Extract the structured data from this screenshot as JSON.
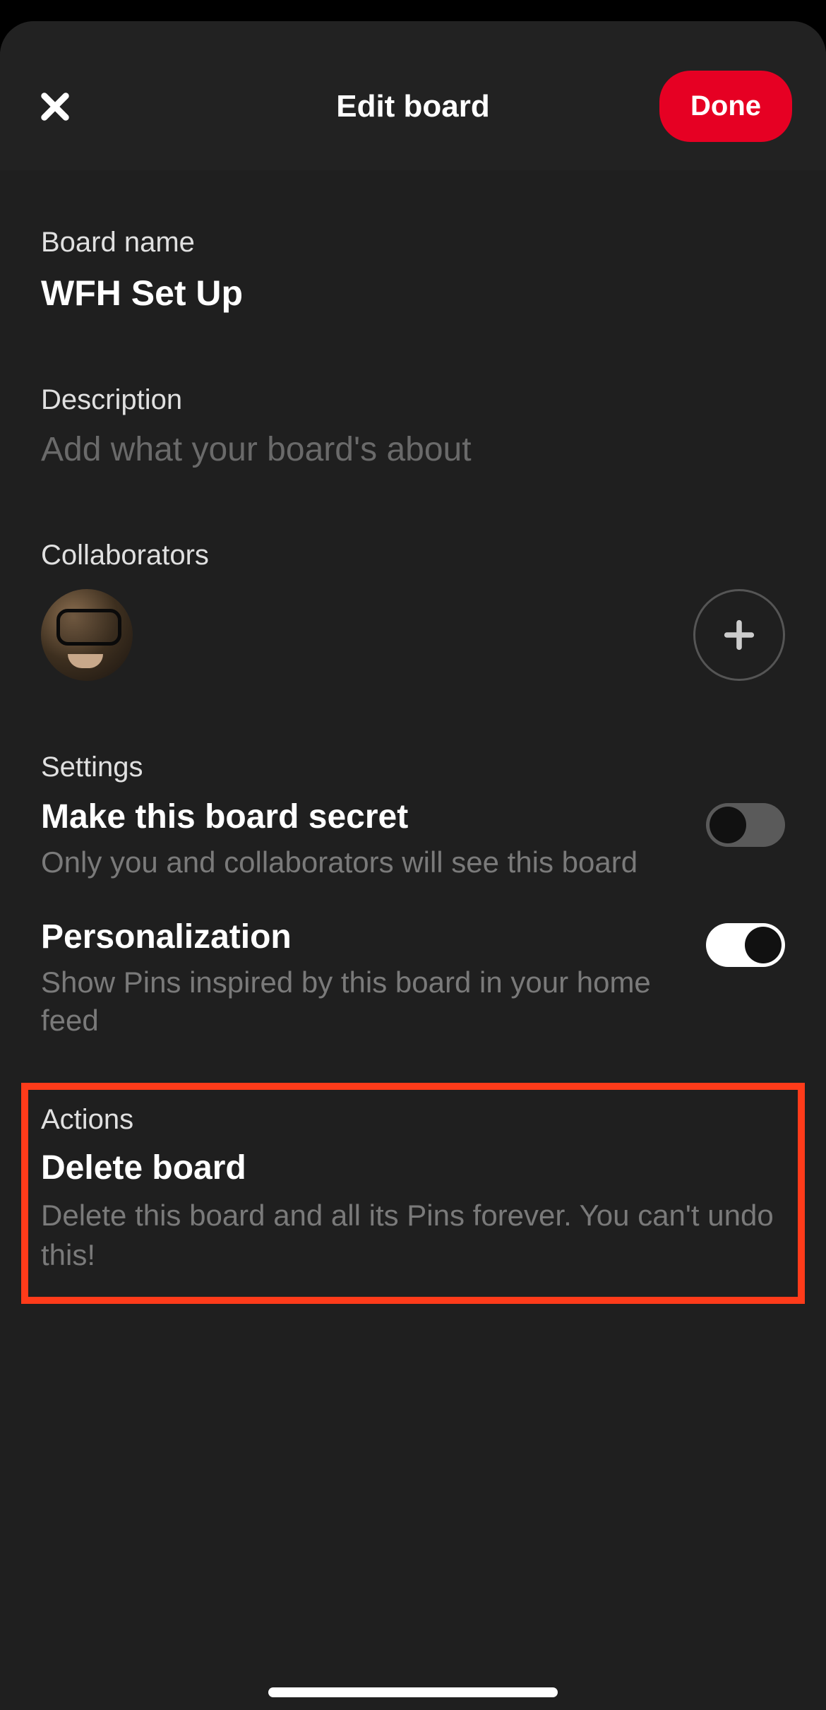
{
  "header": {
    "title": "Edit board",
    "done_label": "Done"
  },
  "board_name": {
    "label": "Board name",
    "value": "WFH Set Up"
  },
  "description": {
    "label": "Description",
    "placeholder": "Add what your board's about"
  },
  "collaborators": {
    "label": "Collaborators"
  },
  "settings": {
    "label": "Settings",
    "secret": {
      "title": "Make this board secret",
      "description": "Only you and collaborators will see this board",
      "enabled": false
    },
    "personalization": {
      "title": "Personalization",
      "description": "Show Pins inspired by this board in your home feed",
      "enabled": true
    }
  },
  "actions": {
    "label": "Actions",
    "delete": {
      "title": "Delete board",
      "description": "Delete this board and all its Pins forever. You can't undo this!"
    }
  }
}
